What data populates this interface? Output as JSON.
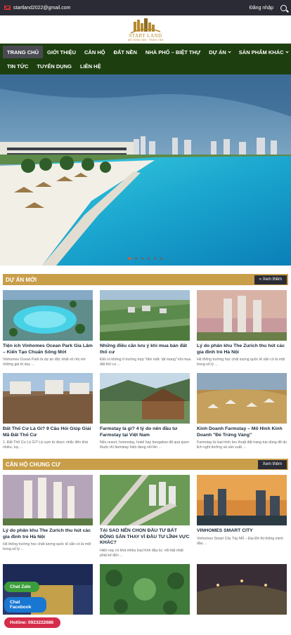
{
  "topbar": {
    "email": "startland2022@gmail.com",
    "login": "Đăng nhập"
  },
  "logo": {
    "text": "START LAND",
    "sub": "BẤT ĐỘNG SẢN · TRUNG TÂM"
  },
  "nav": {
    "row1": [
      {
        "label": "TRANG CHỦ",
        "active": true
      },
      {
        "label": "GIỚI THIỆU"
      },
      {
        "label": "CĂN HỘ"
      },
      {
        "label": "ĐẤT NỀN"
      },
      {
        "label": "NHÀ PHỐ – BIỆT THỰ"
      },
      {
        "label": "DỰ ÁN"
      },
      {
        "label": "SẢN PHẨM KHÁC"
      }
    ],
    "row2": [
      {
        "label": "TIN TỨC"
      },
      {
        "label": "TUYỂN DỤNG"
      },
      {
        "label": "LIÊN HỆ"
      }
    ]
  },
  "sections": [
    {
      "title": "DỰ ÁN MỚI",
      "more": "» Xem thêm",
      "cards": [
        {
          "title": "Tiện ích Vinhomes Ocean Park Gia Lâm – Kiến Tạo Chuẩn Sống Mới",
          "excerpt": "Vinhomes Ocean Park là dự án độc nhất vô nhị với những giá trị duy ..."
        },
        {
          "title": "Những điều cần lưu ý khi mua bán đất thổ cư",
          "excerpt": "Đất có không ít trường hợp \"tiền mất- tật mang\" khi mua đất thổ cư ..."
        },
        {
          "title": "Lý do phân khu The Zurich thu hút các gia đình trẻ Hà Nội",
          "excerpt": "Hệ thống trường học chất lượng quốc tế sẵn có là một trong số lý ..."
        },
        {
          "title": "Đất Thổ Cư Là Gì? 9 Câu Hỏi Giúp Giải Mã Đất Thổ Cư",
          "excerpt": "1. Đất Thổ Cư Là Gì? Là cụm từ được nhắc đến khá nhiều, tuy ..."
        },
        {
          "title": "Farmstay là gì? 4 lý do nên đầu tư Farmstay tại Việt Nam",
          "excerpt": "Nếu resort, homestay, hotel hay bungalow đã quá quen thuộc thì farmstay hiện đang nổi lên ..."
        },
        {
          "title": "Kinh Doanh Farmstay – Mô Hình Kinh Doanh \"Đẻ Trứng Vàng\"",
          "excerpt": "Farmstay là loại hình lưu thuật đất trang trại dùng để du lịch nghỉ dưỡng và sản xuất ..."
        }
      ]
    },
    {
      "title": "CĂN HỘ CHUNG CƯ",
      "more": "Xem thêm",
      "cards": [
        {
          "title": "Lý do phân khu The Zurich thu hút các gia đình trẻ Hà Nội",
          "excerpt": "Hệ thống trường học chất lượng quốc tế sẵn có là một trong số lý ..."
        },
        {
          "title": "TẠI SAO NÊN CHỌN ĐẦU TƯ BẤT ĐỘNG SẢN THAY VÌ ĐẦU TƯ LĨNH VỰC KHÁC?",
          "excerpt": "Hiện nay có khá nhiều loại hình đầu tư, nổi bật nhất phải kể đến ..."
        },
        {
          "title": "VINHOMES SMART CITY",
          "excerpt": "Vinhomes Smart City Tây Mỗ – Đại Đô thị thông minh đầu ..."
        },
        {
          "title": "",
          "excerpt": ""
        },
        {
          "title": "",
          "excerpt": ""
        },
        {
          "title": "",
          "excerpt": ""
        }
      ]
    }
  ],
  "floating": {
    "zalo": "Chat Zalo",
    "facebook": "Chat Facebook",
    "hotline": "Hotline: 0923222686"
  },
  "colors": {
    "nav_bg": "#1d3f0f",
    "topbar_bg": "#2b2b35",
    "section_bar": "#c89e49",
    "accent_dot": "#e25a25"
  },
  "icons": [
    "mail-icon",
    "search-icon",
    "chevron-down-icon"
  ]
}
